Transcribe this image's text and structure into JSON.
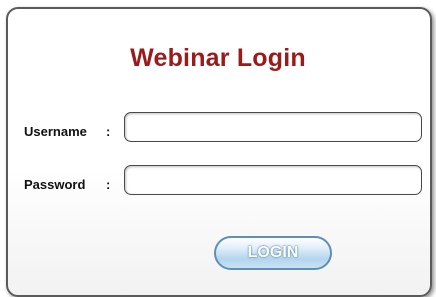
{
  "login": {
    "title": "Webinar Login",
    "username_label": "Username",
    "password_label": "Password",
    "colon": ":",
    "username_value": "",
    "password_value": "",
    "login_button": "LOGIN"
  },
  "colors": {
    "title": "#9b1b1b",
    "button_border": "#5f8fb7",
    "panel_border": "#5a5a5a"
  }
}
